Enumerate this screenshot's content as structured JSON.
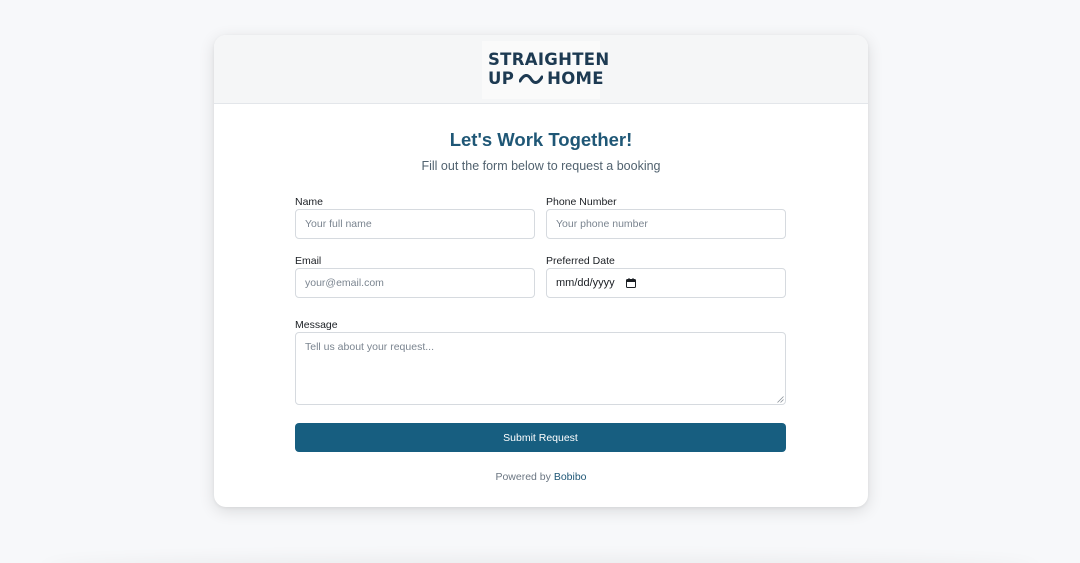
{
  "logo": {
    "line1": "STRAIGHTEN",
    "line2_left": "UP",
    "line2_right": "HOME"
  },
  "form": {
    "title": "Let's Work Together!",
    "subtitle": "Fill out the form below to request a booking",
    "fields": {
      "name": {
        "label": "Name",
        "placeholder": "Your full name"
      },
      "phone": {
        "label": "Phone Number",
        "placeholder": "Your phone number"
      },
      "email": {
        "label": "Email",
        "placeholder": "your@email.com"
      },
      "date": {
        "label": "Preferred Date",
        "value": "mm/dd/yyyy",
        "icon": "calendar-icon"
      },
      "message": {
        "label": "Message",
        "placeholder": "Tell us about your request..."
      }
    },
    "submit_label": "Submit Request"
  },
  "footer": {
    "powered_prefix": "Powered by",
    "powered_link": "Bobibo"
  },
  "colors": {
    "brand_dark": "#1d3a52",
    "title": "#1f5776",
    "button": "#175e80",
    "background": "#f7f8fa"
  }
}
